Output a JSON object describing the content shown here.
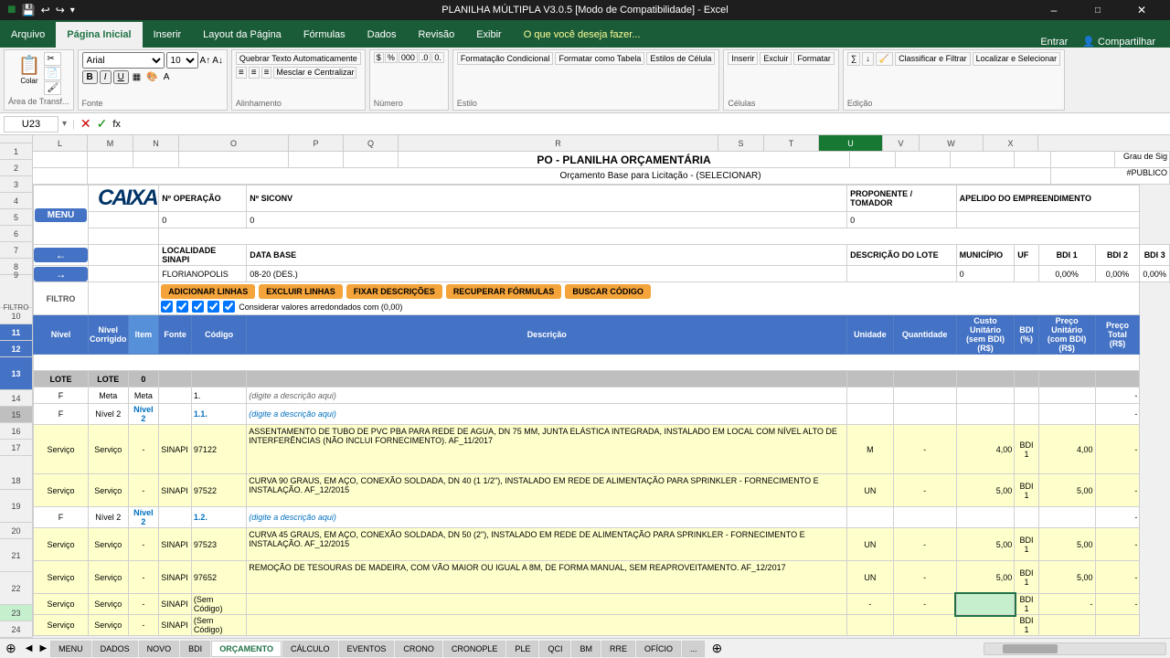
{
  "titlebar": {
    "title": "PLANILHA MÚLTIPLA V3.0.5 [Modo de Compatibilidade] - Excel",
    "controls": [
      "–",
      "□",
      "✕"
    ]
  },
  "ribbon": {
    "tabs": [
      "Arquivo",
      "Página Inicial",
      "Inserir",
      "Layout da Página",
      "Fórmulas",
      "Dados",
      "Revisão",
      "Exibir",
      "O que você deseja fazer..."
    ],
    "active_tab": "Página Inicial",
    "groups": {
      "clipboard": "Área de Transf...",
      "font": "Fonte",
      "alignment": "Alinhamento",
      "number": "Número",
      "styles": "Estilo",
      "cells": "Células",
      "editing": "Edição"
    }
  },
  "formula_bar": {
    "cell_ref": "U23",
    "formula": ""
  },
  "header": {
    "title": "PO - PLANILHA ORÇAMENTÁRIA",
    "subtitle": "Orçamento Base para Licitação - (SELECIONAR)",
    "nr_operacao_label": "Nº OPERAÇÃO",
    "nr_operacao_value": "0",
    "nr_siconv_label": "Nº SICONV",
    "nr_siconv_value": "0",
    "proponente_label": "PROPONENTE / TOMADOR",
    "proponente_value": "0",
    "apelido_label": "APELIDO DO EMPREENDIMENTO",
    "localidade_label": "LOCALIDADE SINAPI",
    "localidade_value": "FLORIANOPOLIS",
    "data_base_label": "DATA BASE",
    "data_base_value": "08-20 (DES.)",
    "descricao_lote_label": "DESCRIÇÃO DO LOTE",
    "municipio_label": "MUNICÍPIO",
    "uf_label": "UF",
    "bdi1_label": "BDI 1",
    "bdi1_value": "0,00%",
    "bdi2_label": "BDI 2",
    "bdi2_value": "0,00%",
    "bdi3_label": "BDI 3",
    "bdi3_value": "0,00%"
  },
  "buttons": {
    "menu": "MENU",
    "prev": "←",
    "next": "→",
    "add_lines": "ADICIONAR LINHAS",
    "del_lines": "EXCLUIR LINHAS",
    "fix_desc": "FIXAR DESCRIÇÕES",
    "recover_formulas": "RECUPERAR FÓRMULAS",
    "buscar_codigo": "BUSCAR CÓDIGO",
    "considerar": "Considerar valores arredondados com (0,00)"
  },
  "table": {
    "col_headers": [
      "L",
      "M",
      "N",
      "O",
      "P",
      "Q",
      "R",
      "S",
      "T",
      "U",
      "V",
      "W",
      "X"
    ],
    "header_row": {
      "nivel": "Nível",
      "nivel_corrigido": "Nível Corrigido",
      "item": "Item",
      "fonte": "Fonte",
      "codigo": "Código",
      "descricao": "Descrição",
      "unidade": "Unidade",
      "quantidade": "Quantidade",
      "custo_unitario": "Custo Unitário (sem BDI) (R$)",
      "bdi": "BDI (%)",
      "preco_unitario": "Preço Unitário (com BDI) (R$)",
      "preco_total": "Preço Total (R$)"
    },
    "rows": [
      {
        "id": 15,
        "type": "lote",
        "nivel": "LOTE",
        "nivel_corrigido": "LOTE",
        "item": "0",
        "fonte": "",
        "codigo": "",
        "descricao": "",
        "unidade": "",
        "quantidade": "",
        "custo": "",
        "bdi": "",
        "preco_unit": "",
        "preco_total": ""
      },
      {
        "id": 16,
        "type": "meta",
        "nivel": "F",
        "nivel_corrigido": "Meta",
        "item": "Meta",
        "fonte": "",
        "codigo": "1.",
        "descricao": "(digite a descrição aqui)",
        "unidade": "",
        "quantidade": "",
        "custo": "",
        "bdi": "",
        "preco_unit": "",
        "preco_total": "-"
      },
      {
        "id": 17,
        "type": "nivel2",
        "nivel": "F",
        "nivel_corrigido": "Nível 2",
        "item": "Nível 2",
        "fonte": "",
        "codigo": "1.1.",
        "descricao": "(digite a descrição aqui)",
        "unidade": "",
        "quantidade": "",
        "custo": "",
        "bdi": "",
        "preco_unit": "",
        "preco_total": "-"
      },
      {
        "id": 18,
        "type": "servico",
        "nivel": "Serviço",
        "nivel_corrigido": "Serviço",
        "item": "-",
        "fonte": "SINAPI",
        "codigo": "97122",
        "descricao": "ASSENTAMENTO DE TUBO DE PVC PBA PARA REDE DE AGUA, DN 75 MM, JUNTA ELÁSTICA INTEGRADA, INSTALADO EM LOCAL COM NÍVEL ALTO DE INTERFERÊNCIAS (NÃO INCLUI FORNECIMENTO). AF_11/2017",
        "unidade": "M",
        "quantidade": "-",
        "custo": "4,00",
        "bdi": "BDI 1",
        "preco_unit": "4,00",
        "preco_total": "-"
      },
      {
        "id": 19,
        "type": "servico",
        "nivel": "Serviço",
        "nivel_corrigido": "Serviço",
        "item": "-",
        "fonte": "SINAPI",
        "codigo": "97522",
        "descricao": "CURVA 90 GRAUS, EM AÇO, CONEXÃO SOLDADA, DN 40 (1 1/2\"), INSTALADO EM REDE DE ALIMENTAÇÃO PARA SPRINKLER - FORNECIMENTO E INSTALAÇÃO. AF_12/2015",
        "unidade": "UN",
        "quantidade": "-",
        "custo": "5,00",
        "bdi": "BDI 1",
        "preco_unit": "5,00",
        "preco_total": "-"
      },
      {
        "id": 20,
        "type": "nivel2",
        "nivel": "F",
        "nivel_corrigido": "Nível 2",
        "item": "Nível 2",
        "fonte": "",
        "codigo": "1.2.",
        "descricao": "(digite a descrição aqui)",
        "unidade": "",
        "quantidade": "",
        "custo": "",
        "bdi": "",
        "preco_unit": "",
        "preco_total": "-"
      },
      {
        "id": 21,
        "type": "servico",
        "nivel": "Serviço",
        "nivel_corrigido": "Serviço",
        "item": "-",
        "fonte": "SINAPI",
        "codigo": "97523",
        "descricao": "CURVA 45 GRAUS, EM AÇO, CONEXÃO SOLDADA, DN 50 (2\"), INSTALADO EM REDE DE ALIMENTAÇÃO PARA SPRINKLER - FORNECIMENTO E INSTALAÇÃO. AF_12/2015",
        "unidade": "UN",
        "quantidade": "-",
        "custo": "5,00",
        "bdi": "BDI 1",
        "preco_unit": "5,00",
        "preco_total": "-"
      },
      {
        "id": 22,
        "type": "servico",
        "nivel": "Serviço",
        "nivel_corrigido": "Serviço",
        "item": "-",
        "fonte": "SINAPI",
        "codigo": "97652",
        "descricao": "REMOÇÃO DE TESOURAS DE MADEIRA, COM VÃO MAIOR OU IGUAL A 8M, DE FORMA MANUAL, SEM REAPROVEITAMENTO. AF_12/2017",
        "unidade": "UN",
        "quantidade": "-",
        "custo": "5,00",
        "bdi": "BDI 1",
        "preco_unit": "5,00",
        "preco_total": "-"
      },
      {
        "id": 23,
        "type": "servico_selected",
        "nivel": "Serviço",
        "nivel_corrigido": "Serviço",
        "item": "-",
        "fonte": "SINAPI",
        "codigo": "(Sem Código)",
        "descricao": "",
        "unidade": "-",
        "quantidade": "-",
        "custo": "",
        "bdi": "BDI 1",
        "preco_unit": "-",
        "preco_total": "-"
      },
      {
        "id": 24,
        "type": "servico",
        "nivel": "Serviço",
        "nivel_corrigido": "Serviço",
        "item": "-",
        "fonte": "SINAPI",
        "codigo": "(Sem Código)",
        "descricao": "",
        "unidade": "",
        "quantidade": "",
        "custo": "",
        "bdi": "BDI 1",
        "preco_unit": "",
        "preco_total": ""
      }
    ],
    "sheet_tabs": [
      "MENU",
      "DADOS",
      "NOVO",
      "BDI",
      "ORÇAMENTO",
      "CÁLCULO",
      "EVENTOS",
      "CRONO",
      "CRONOPLE",
      "PLE",
      "QCI",
      "BM",
      "RRE",
      "OFÍCIO",
      "..."
    ]
  },
  "grau_sig": {
    "label": "Grau de Sig",
    "value": "#PUBLICO"
  }
}
